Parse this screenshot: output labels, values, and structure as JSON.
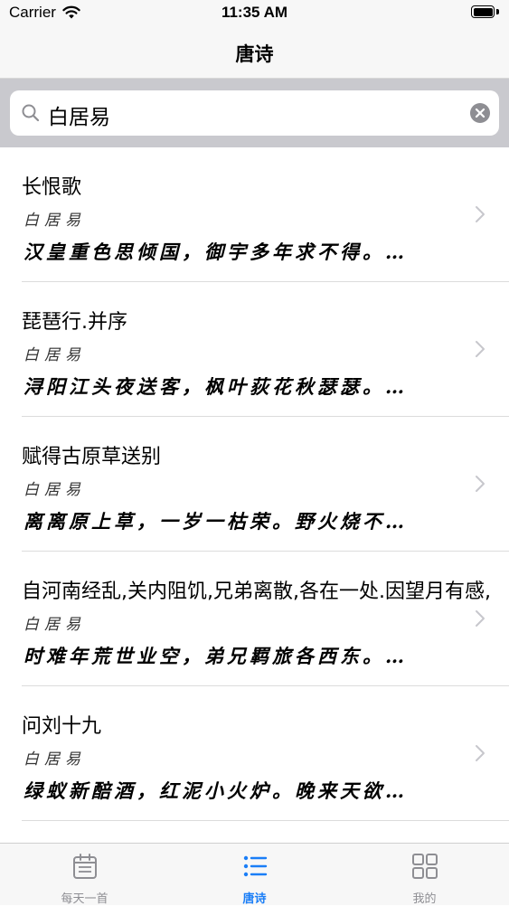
{
  "status_bar": {
    "carrier": "Carrier",
    "time": "11:35 AM"
  },
  "nav": {
    "title": "唐诗"
  },
  "search": {
    "query": "白居易"
  },
  "poems": [
    {
      "title": "长恨歌",
      "author": "白居易",
      "excerpt": "汉皇重色思倾国，御宇多年求不得。…"
    },
    {
      "title": "琵琶行.并序",
      "author": "白居易",
      "excerpt": "浔阳江头夜送客，枫叶荻花秋瑟瑟。…"
    },
    {
      "title": "赋得古原草送别",
      "author": "白居易",
      "excerpt": "离离原上草，一岁一枯荣。野火烧不…"
    },
    {
      "title": "自河南经乱,关内阻饥,兄弟离散,各在一处.因望月有感,",
      "author": "白居易",
      "excerpt": "时难年荒世业空，弟兄羁旅各西东。…"
    },
    {
      "title": "问刘十九",
      "author": "白居易",
      "excerpt": "绿蚁新醅酒，红泥小火炉。晚来天欲…"
    }
  ],
  "tabs": [
    {
      "label": "每天一首",
      "icon": "calendar-icon"
    },
    {
      "label": "唐诗",
      "icon": "list-icon"
    },
    {
      "label": "我的",
      "icon": "grid-icon"
    }
  ],
  "colors": {
    "accent": "#1a7ef7",
    "inactive": "#8e8e93"
  }
}
